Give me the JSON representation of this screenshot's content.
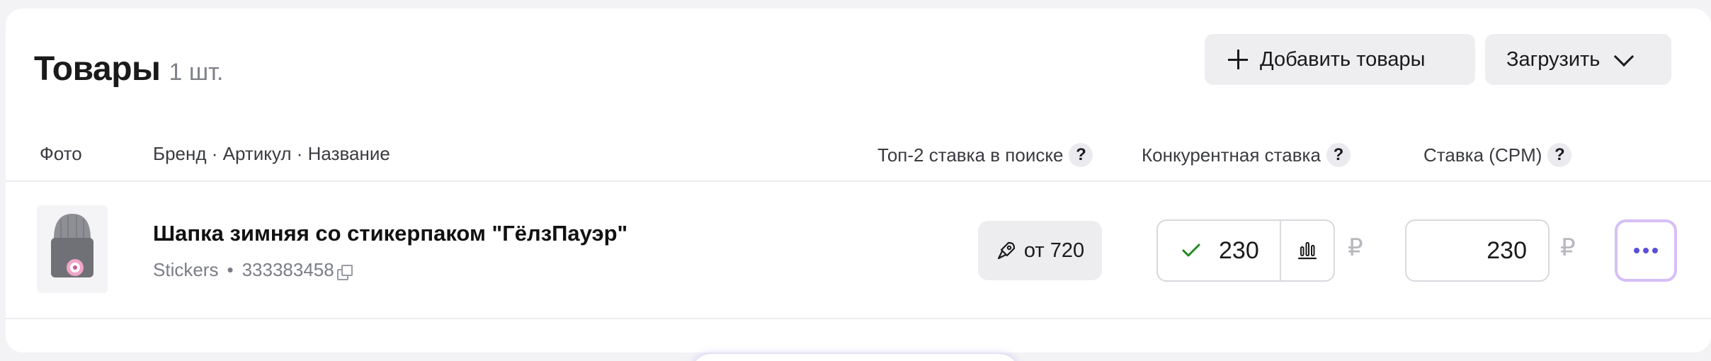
{
  "header": {
    "title": "Товары",
    "count": "1 шт.",
    "add_button": "Добавить товары",
    "upload_button": "Загрузить"
  },
  "columns": {
    "photo": "Фото",
    "brand_article_name": "Бренд · Артикул · Название",
    "top2_bid": "Топ-2 ставка в поиске",
    "competitive_bid": "Конкурентная ставка",
    "cpm_bid": "Ставка (CPM)",
    "help": "?"
  },
  "product": {
    "name": "Шапка зимняя со стикерпаком \"ГёлзПауэр\"",
    "brand": "Stickers",
    "separator": "•",
    "article": "333383458",
    "top2_label": "от 720",
    "competitive_value": "230",
    "cpm_value": "230",
    "currency": "₽"
  },
  "icons": {
    "add": "plus-icon",
    "upload": "chevron-down-icon",
    "top2": "rocket-icon",
    "competitive_ok": "check-icon",
    "stats": "bar-chart-icon",
    "copy": "copy-icon",
    "more": "more-horizontal-icon"
  },
  "colors": {
    "accent": "#5b4fd6",
    "accent_border": "#d6bff7",
    "check": "#1f8a1f",
    "muted": "#7b7d85"
  }
}
